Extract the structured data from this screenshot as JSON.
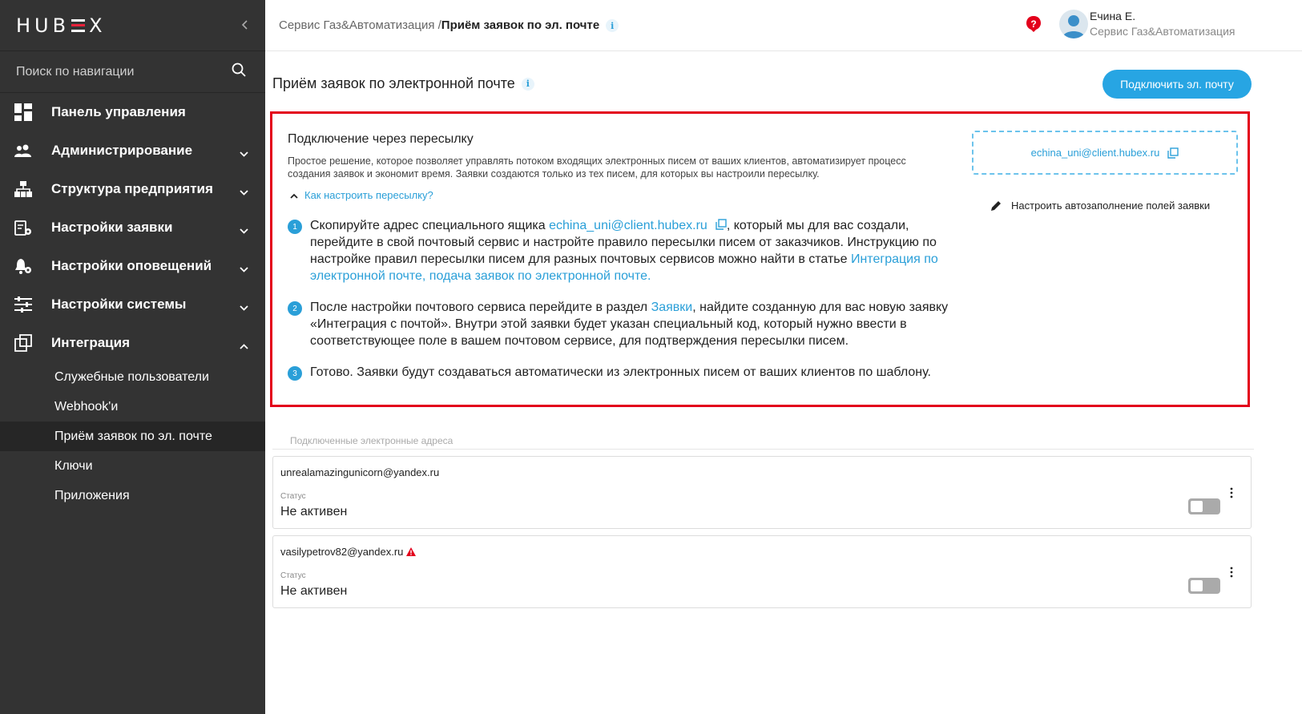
{
  "colors": {
    "sidebar_bg": "#333333",
    "accent": "#27a5e3",
    "highlight_border": "#e3001b",
    "warning": "#e3001b"
  },
  "sidebar": {
    "logo": "HUBEX",
    "search_placeholder": "Поиск по навигации",
    "items": [
      {
        "label": "Панель управления",
        "icon": "dashboard-icon",
        "chevron": "none"
      },
      {
        "label": "Администрирование",
        "icon": "users-icon",
        "chevron": "down"
      },
      {
        "label": "Структура предприятия",
        "icon": "hierarchy-icon",
        "chevron": "down"
      },
      {
        "label": "Настройки заявки",
        "icon": "ticket-settings-icon",
        "chevron": "down"
      },
      {
        "label": "Настройки оповещений",
        "icon": "bell-settings-icon",
        "chevron": "down"
      },
      {
        "label": "Настройки системы",
        "icon": "sliders-icon",
        "chevron": "down"
      },
      {
        "label": "Интеграция",
        "icon": "integration-icon",
        "chevron": "up"
      }
    ],
    "sub_items": [
      {
        "label": "Служебные пользователи",
        "active": false
      },
      {
        "label": "Webhook'и",
        "active": false
      },
      {
        "label": "Приём заявок по эл. почте",
        "active": true
      },
      {
        "label": "Ключи",
        "active": false
      },
      {
        "label": "Приложения",
        "active": false
      }
    ]
  },
  "header": {
    "breadcrumb_parent": "Сервис Газ&Автоматизация /",
    "breadcrumb_current": "Приём заявок по эл. почте",
    "user_name": "Ечина Е.",
    "user_org": "Сервис Газ&Автоматизация"
  },
  "main": {
    "title": "Приём заявок по электронной почте",
    "connect_button": "Подключить эл. почту",
    "panel": {
      "title": "Подключение через пересылку",
      "description": "Простое решение, которое позволяет управлять потоком входящих электронных писем от ваших клиентов, автоматизирует процесс создания заявок и экономит время. Заявки создаются только из тех писем, для которых вы настроили пересылку.",
      "howto_link": "Как настроить пересылку?",
      "forward_email": "echina_uni@client.hubex.ru",
      "autofill_link": "Настроить автозаполнение полей заявки",
      "steps": [
        {
          "num": "1",
          "before": "Скопируйте адрес специального ящика ",
          "link": "echina_uni@client.hubex.ru",
          "after": ", который мы для вас создали, перейдите в свой почтовый сервис и настройте правило пересылки писем от заказчиков. Инструкцию по настройке правил пересылки писем для разных почтовых сервисов можно найти в статье ",
          "link2": "Интеграция по электронной почте, подача заявок по электронной почте."
        },
        {
          "num": "2",
          "before": "После настройки почтового сервиса перейдите в раздел ",
          "link": "Заявки",
          "after": ", найдите созданную для вас новую заявку «Интеграция с почтой». Внутри этой заявки будет указан специальный код, который нужно ввести в соответствующее поле в вашем почтовом сервисе, для подтверждения пересылки писем."
        },
        {
          "num": "3",
          "text": "Готово. Заявки будут создаваться автоматически из электронных писем от ваших клиентов по шаблону."
        }
      ]
    },
    "connected_label": "Подключенные электронные адреса",
    "connected": [
      {
        "email": "unrealamazingunicorn@yandex.ru",
        "status_label": "Статус",
        "status": "Не активен",
        "warning": false,
        "enabled": false
      },
      {
        "email": "vasilypetrov82@yandex.ru",
        "status_label": "Статус",
        "status": "Не активен",
        "warning": true,
        "enabled": false
      }
    ]
  }
}
